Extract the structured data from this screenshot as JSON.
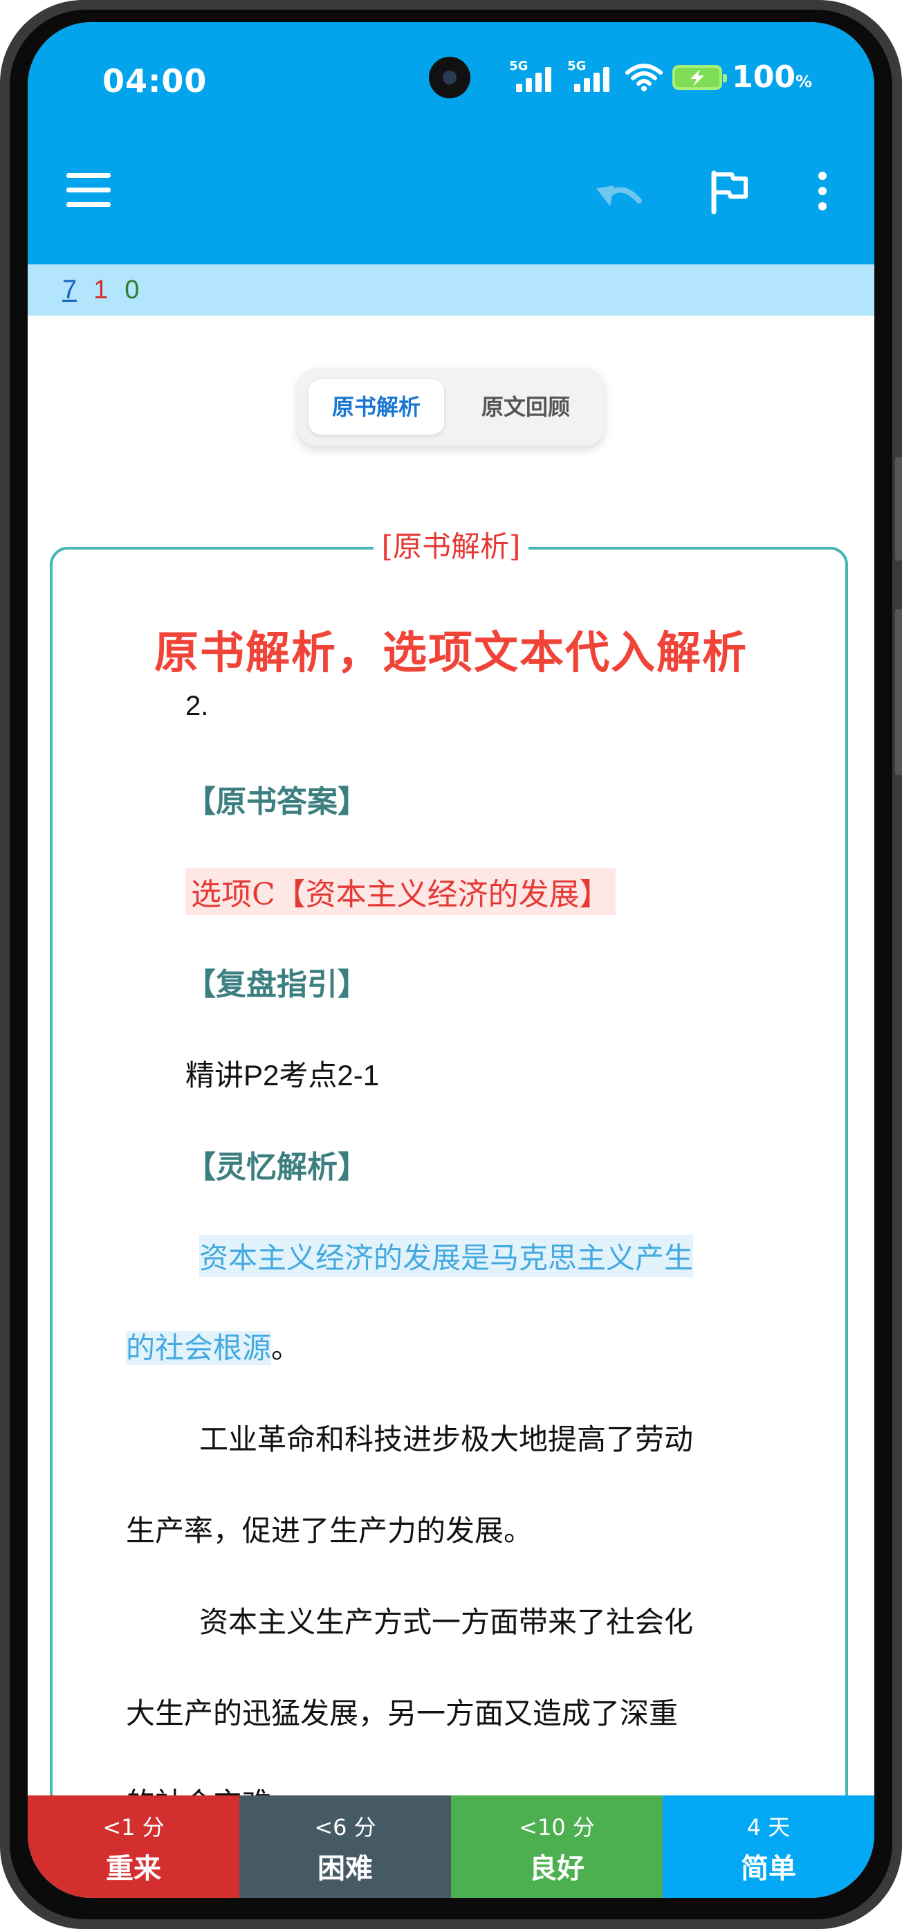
{
  "status": {
    "time": "04:00",
    "battery": "100",
    "battery_unit": "%",
    "signal_label_1": "5G",
    "signal_label_2": "5G"
  },
  "toolbar": {
    "menu_icon": "hamburger-icon",
    "undo_icon": "undo-icon",
    "flag_icon": "flag-icon",
    "more_icon": "more-vert-icon"
  },
  "counts": {
    "new": "7",
    "learn": "1",
    "review": "0"
  },
  "tabs": [
    {
      "label": "原书解析",
      "active": true
    },
    {
      "label": "原文回顾",
      "active": false
    }
  ],
  "card": {
    "box_title": "[原书解析]",
    "headline": "原书解析，选项文本代入解析",
    "number": "2.",
    "answer_heading": "【原书答案】",
    "answer": "选项C【资本主义经济的发展】",
    "guide_heading": "【复盘指引】",
    "guide": "精讲P2考点2-1",
    "analysis_heading": "【灵忆解析】",
    "analysis_hl_1": "资本主义经济的发展是马克思主义产生",
    "analysis_hl_2": "的社会根源",
    "analysis_end": "。",
    "p1_line1": "工业革命和科技进步极大地提高了劳动",
    "p1_line2": "生产率，促进了生产力的发展。",
    "p2_line1": "资本主义生产方式一方面带来了社会化",
    "p2_line2": "大生产的迅猛发展，另一方面又造成了深重",
    "p2_line3": "的社会灾难。"
  },
  "answer_buttons": [
    {
      "interval": "<1 分",
      "label": "重来",
      "color": "#d32f2f"
    },
    {
      "interval": "<6 分",
      "label": "困难",
      "color": "#455a64"
    },
    {
      "interval": "<10 分",
      "label": "良好",
      "color": "#4caf50"
    },
    {
      "interval": "4 天",
      "label": "简单",
      "color": "#03a9f4"
    }
  ]
}
